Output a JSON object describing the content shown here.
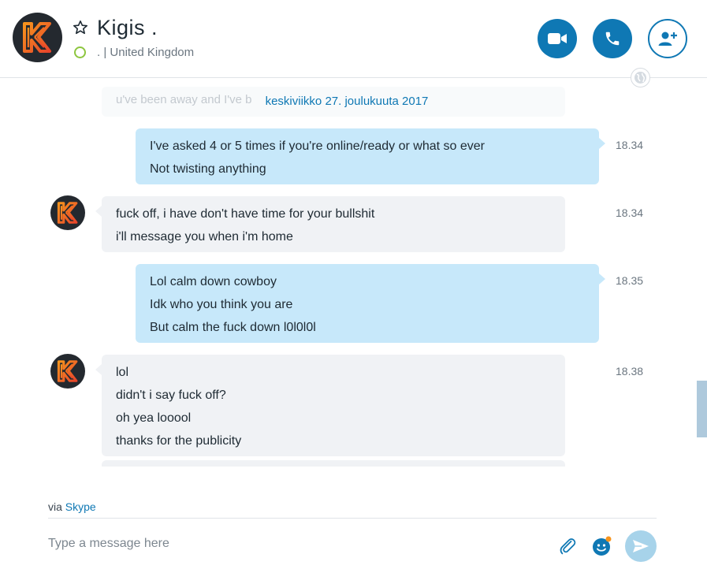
{
  "header": {
    "contact_name": "Kigis .",
    "status_text": ". | United Kingdom",
    "presence": "online-ring",
    "accent_color": "#0f78b4"
  },
  "icons": {
    "avatar": "kigis-logo-avatar",
    "favorite": "star-outline-icon",
    "video": "video-camera-icon",
    "call": "phone-icon",
    "add_people": "add-person-icon",
    "globe": "globe-icon",
    "attach": "paperclip-icon",
    "emoji": "emoji-icon",
    "send": "send-icon"
  },
  "conversation": {
    "ghost_text": "u've been away and I've b",
    "date_separator": "keskiviikko 27. joulukuuta 2017",
    "messages": [
      {
        "direction": "out",
        "time": "18.34",
        "lines": [
          "I've asked 4 or 5 times if you're online/ready or what so ever",
          "Not twisting anything"
        ]
      },
      {
        "direction": "in",
        "time": "18.34",
        "lines": [
          "fuck off, i have don't have time for your bullshit",
          "i'll message you when i'm home"
        ]
      },
      {
        "direction": "out",
        "time": "18.35",
        "lines": [
          "Lol calm down cowboy",
          "Idk who you think you are",
          "But calm the fuck down l0l0l0l"
        ]
      },
      {
        "direction": "in",
        "time": "18.38",
        "lines": [
          "lol",
          "didn't i say fuck off?",
          "oh yea looool",
          "thanks for the publicity"
        ]
      }
    ]
  },
  "composer": {
    "via_prefix": "via",
    "via_link": "Skype",
    "placeholder": "Type a message here",
    "value": ""
  }
}
